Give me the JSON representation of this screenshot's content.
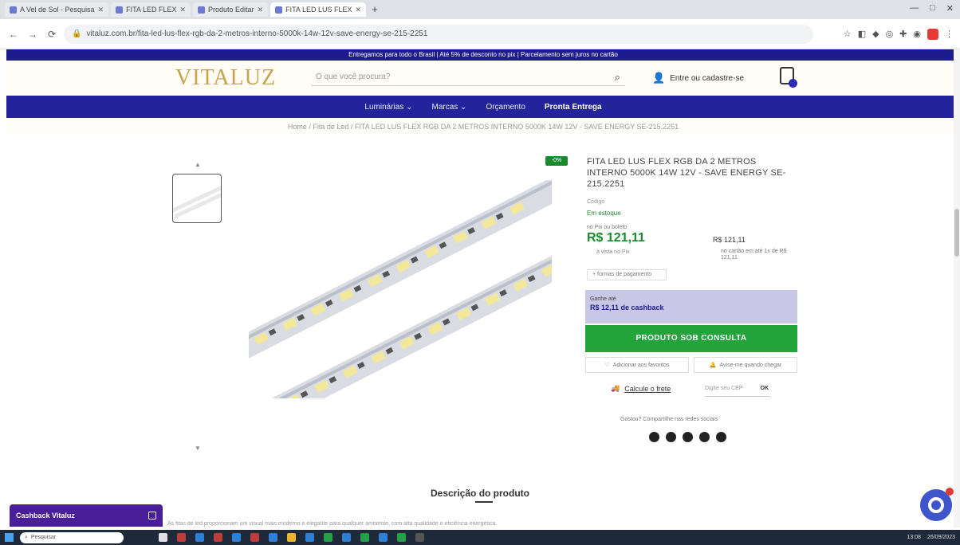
{
  "browser": {
    "tabs": [
      {
        "label": "A Vel de Sol - Pesquisa",
        "active": false
      },
      {
        "label": "FITA LED FLEX",
        "active": false
      },
      {
        "label": "Produto Editar",
        "active": false
      },
      {
        "label": "FITA LED LUS FLEX",
        "active": true
      }
    ],
    "new_tab": "+",
    "window_controls": [
      "—",
      "□",
      "✕"
    ],
    "url": "vitaluz.com.br/fita-led-lus-flex-rgb-da-2-metros-interno-5000k-14w-12v-save-energy-se-215-2251",
    "nav": {
      "back": "←",
      "forward": "→",
      "reload": "⟳"
    }
  },
  "site": {
    "promo_bar": "Entregamos para todo o Brasil | Até 5% de desconto no pix | Parcelamento sem juros no cartão",
    "logo": "VITALUZ",
    "search_placeholder": "O que você procura?",
    "login_text": "Entre ou cadastre-se",
    "nav_items": [
      {
        "label": "Luminárias ⌄",
        "bold": false
      },
      {
        "label": "Marcas ⌄",
        "bold": false
      },
      {
        "label": "Orçamento",
        "bold": false
      },
      {
        "label": "Pronta Entrega",
        "bold": true
      }
    ],
    "breadcrumb": "Home / Fita de Led / FITA LED LUS FLEX RGB DA 2 METROS INTERNO 5000K 14W 12V - SAVE ENERGY SE-215.2251"
  },
  "product": {
    "sale_badge": "-0%",
    "title": "FITA LED LUS FLEX RGB DA 2 METROS INTERNO 5000K 14W 12V - SAVE ENERGY SE-215.2251",
    "sku": "Código",
    "stock": "Em estoque",
    "price_label": "no Pix ou boleto",
    "price": "R$ 121,11",
    "price_note": "à vista no Pix",
    "price_alt": "R$ 121,11",
    "price_alt_note": "no cartão em até 1x de R$ 121,11",
    "installments": "+ formas de pagamento",
    "cashback_small": "Ganhe até",
    "cashback_big": "R$ 12,11 de cashback",
    "buy_button": "PRODUTO SOB CONSULTA",
    "actions": [
      {
        "label": "Adicionar aos favoritos",
        "icon": "heart-icon"
      },
      {
        "label": "Avise-me quando chegar",
        "icon": "bell-icon"
      }
    ],
    "freight_label": "Calcule o frete",
    "cep_placeholder": "Digite seu CEP",
    "cep_ok": "OK",
    "share_text": "Gostou? Compartilhe nas redes sociais",
    "social_icons": [
      "facebook-icon",
      "whatsapp-icon",
      "twitter-icon",
      "pinterest-icon",
      "email-icon"
    ],
    "description_title": "Descrição do produto",
    "description_text": "As fitas de led proporcionam um visual mais moderno e elegante para qualquer ambiente, com alta qualidade e eficiência energética."
  },
  "widgets": {
    "cashback_widget": "Cashback Vitaluz"
  },
  "taskbar": {
    "search_placeholder": "Pesquisar",
    "tray_time": "13:08",
    "tray_date": "26/09/2023",
    "app_colors": [
      "#e0e0e0",
      "#c23b3b",
      "#2e7fd6",
      "#c23b3b",
      "#2e7fd6",
      "#c23b3b",
      "#2e7fd6",
      "#f0b429",
      "#2e7fd6",
      "#24a148",
      "#2e7fd6",
      "#24a148",
      "#2e7fd6",
      "#24a148",
      "#555555"
    ]
  }
}
